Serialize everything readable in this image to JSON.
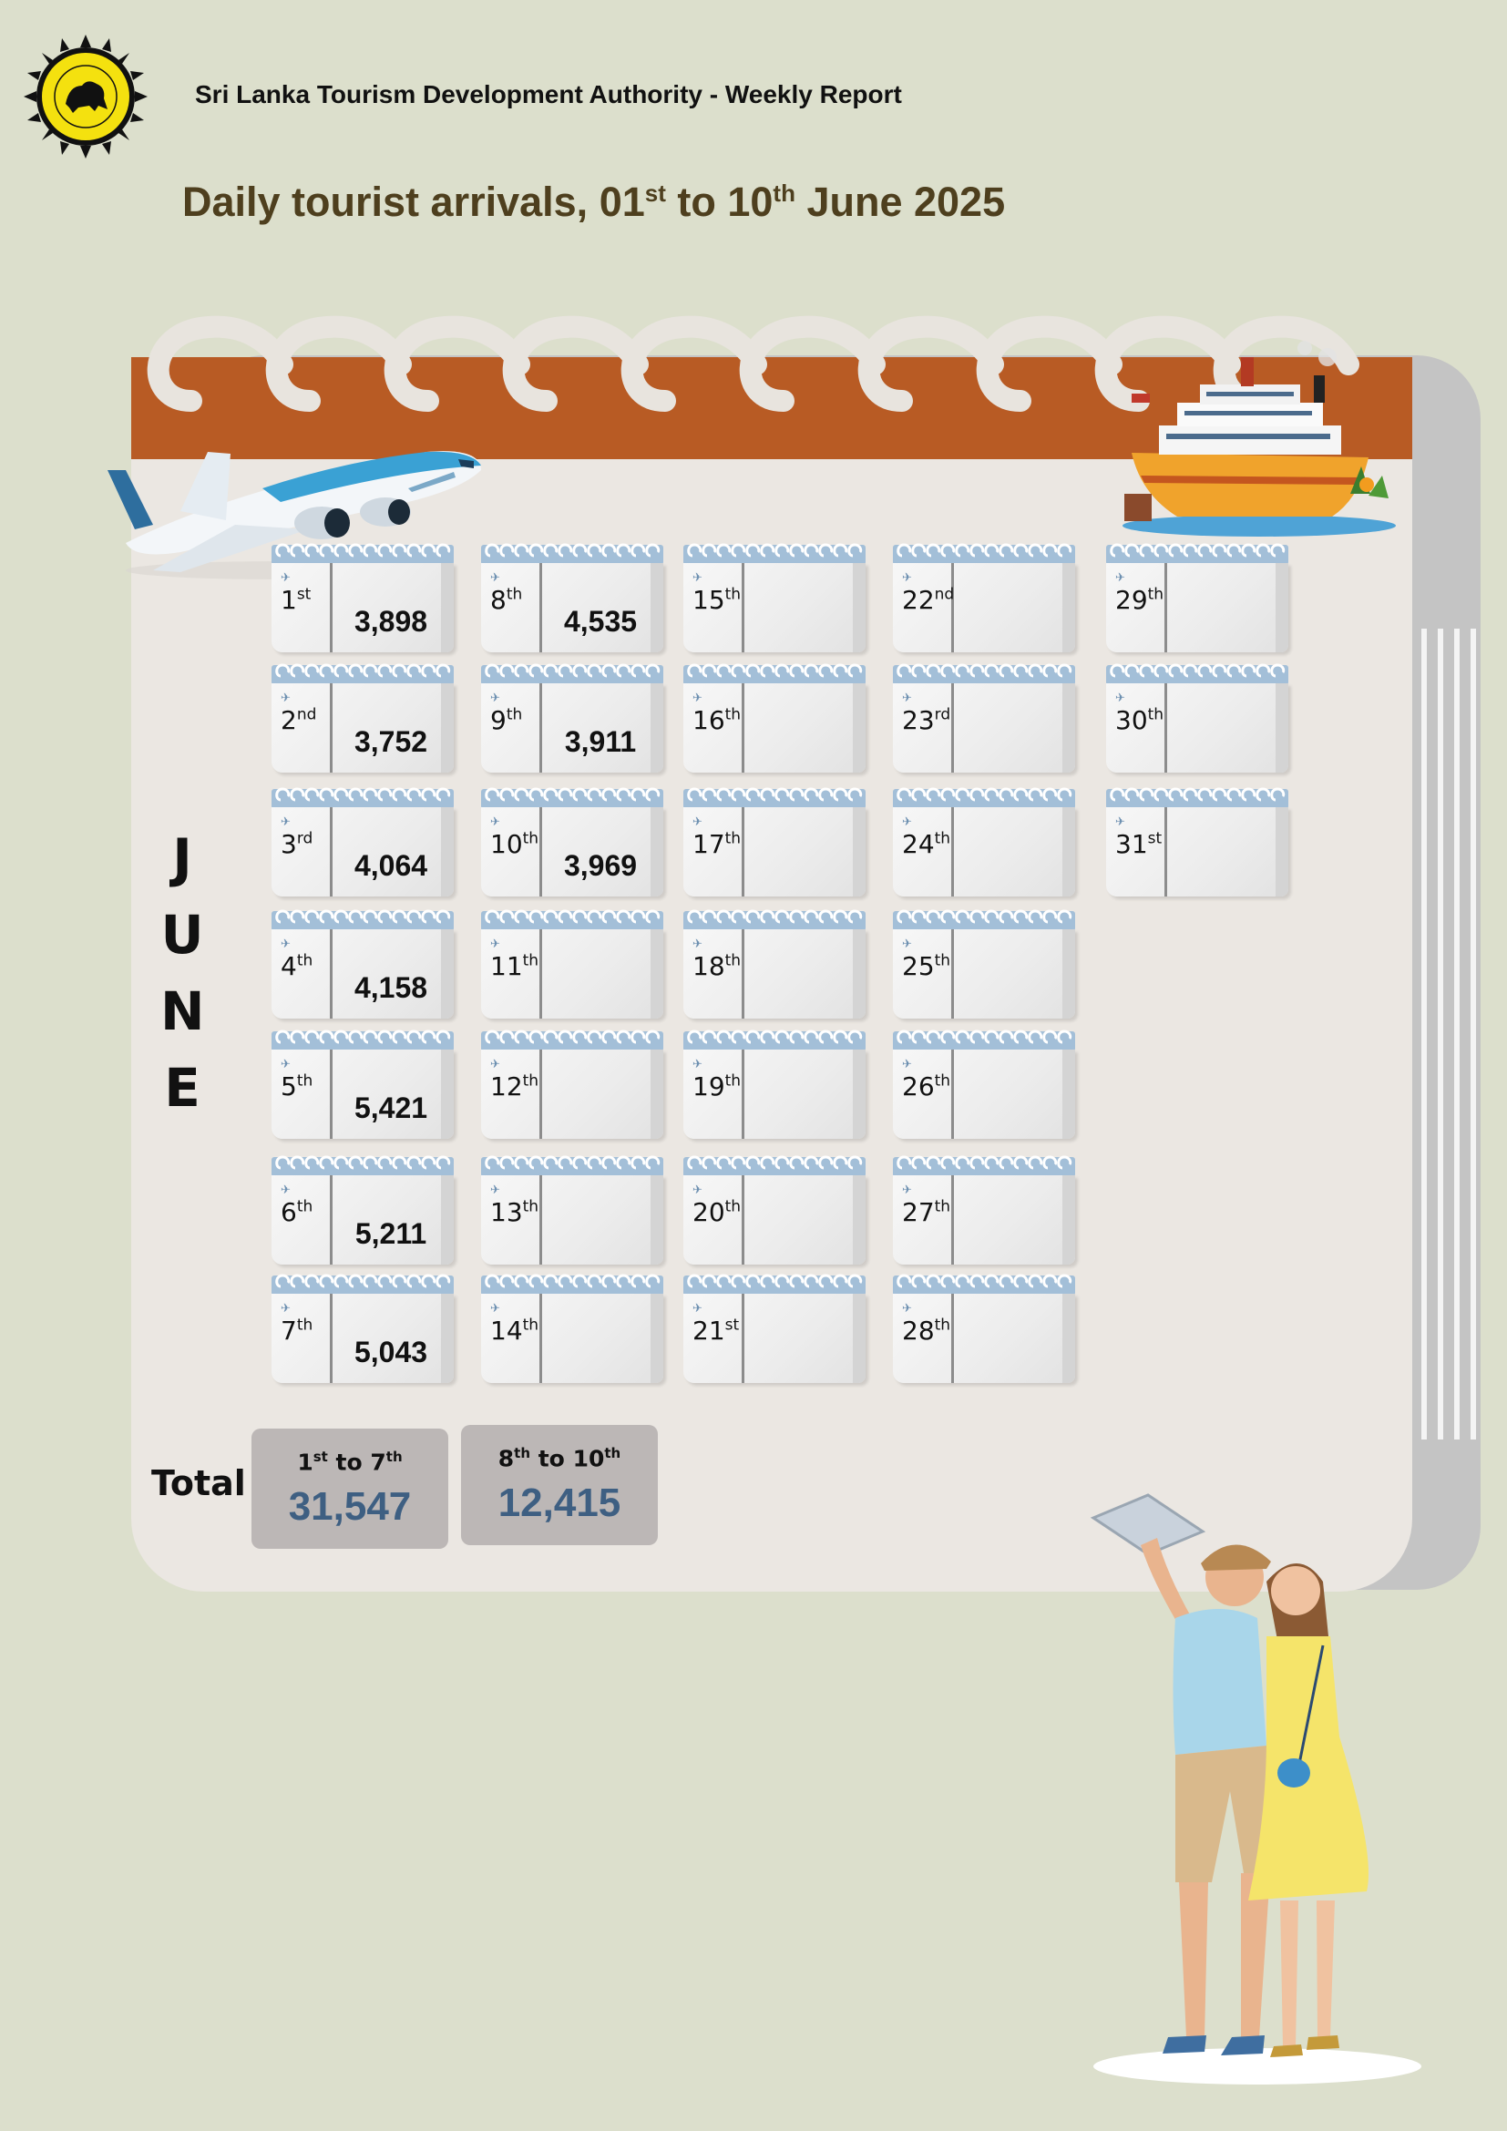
{
  "header": {
    "org_title": "Sri Lanka Tourism Development Authority - Weekly Report"
  },
  "title": {
    "prefix": "Daily tourist arrivals, 01",
    "sup1": "st",
    "middle": " to 10",
    "sup2": "th",
    "suffix": " June 2025"
  },
  "month_letters": [
    "J",
    "U",
    "N",
    "E"
  ],
  "days": [
    {
      "day": "1",
      "suffix": "st",
      "count": "3,898"
    },
    {
      "day": "2",
      "suffix": "nd",
      "count": "3,752"
    },
    {
      "day": "3",
      "suffix": "rd",
      "count": "4,064"
    },
    {
      "day": "4",
      "suffix": "th",
      "count": "4,158"
    },
    {
      "day": "5",
      "suffix": "th",
      "count": "5,421"
    },
    {
      "day": "6",
      "suffix": "th",
      "count": "5,211"
    },
    {
      "day": "7",
      "suffix": "th",
      "count": "5,043"
    },
    {
      "day": "8",
      "suffix": "th",
      "count": "4,535"
    },
    {
      "day": "9",
      "suffix": "th",
      "count": "3,911"
    },
    {
      "day": "10",
      "suffix": "th",
      "count": "3,969"
    },
    {
      "day": "11",
      "suffix": "th",
      "count": ""
    },
    {
      "day": "12",
      "suffix": "th",
      "count": ""
    },
    {
      "day": "13",
      "suffix": "th",
      "count": ""
    },
    {
      "day": "14",
      "suffix": "th",
      "count": ""
    },
    {
      "day": "15",
      "suffix": "th",
      "count": ""
    },
    {
      "day": "16",
      "suffix": "th",
      "count": ""
    },
    {
      "day": "17",
      "suffix": "th",
      "count": ""
    },
    {
      "day": "18",
      "suffix": "th",
      "count": ""
    },
    {
      "day": "19",
      "suffix": "th",
      "count": ""
    },
    {
      "day": "20",
      "suffix": "th",
      "count": ""
    },
    {
      "day": "21",
      "suffix": "st",
      "count": ""
    },
    {
      "day": "22",
      "suffix": "nd",
      "count": ""
    },
    {
      "day": "23",
      "suffix": "rd",
      "count": ""
    },
    {
      "day": "24",
      "suffix": "th",
      "count": ""
    },
    {
      "day": "25",
      "suffix": "th",
      "count": ""
    },
    {
      "day": "26",
      "suffix": "th",
      "count": ""
    },
    {
      "day": "27",
      "suffix": "th",
      "count": ""
    },
    {
      "day": "28",
      "suffix": "th",
      "count": ""
    },
    {
      "day": "29",
      "suffix": "th",
      "count": ""
    },
    {
      "day": "30",
      "suffix": "th",
      "count": ""
    },
    {
      "day": "31",
      "suffix": "st",
      "count": ""
    }
  ],
  "totals": {
    "label": "Total",
    "week1": {
      "from": "1",
      "from_sup": "st",
      "to_word": " to ",
      "to": "7",
      "to_sup": "th",
      "value": "31,547"
    },
    "week2": {
      "from": "8",
      "from_sup": "th",
      "to_word": " to ",
      "to": "10",
      "to_sup": "th",
      "value": "12,415"
    }
  },
  "colors": {
    "background": "#dcdfcc",
    "topbar": "#b85b24",
    "title": "#4e3f1e",
    "total_value": "#3e5f82"
  },
  "icons": [
    "sltda-logo-icon",
    "airplane-icon",
    "cruise-ship-icon",
    "tourist-couple-illustration"
  ]
}
